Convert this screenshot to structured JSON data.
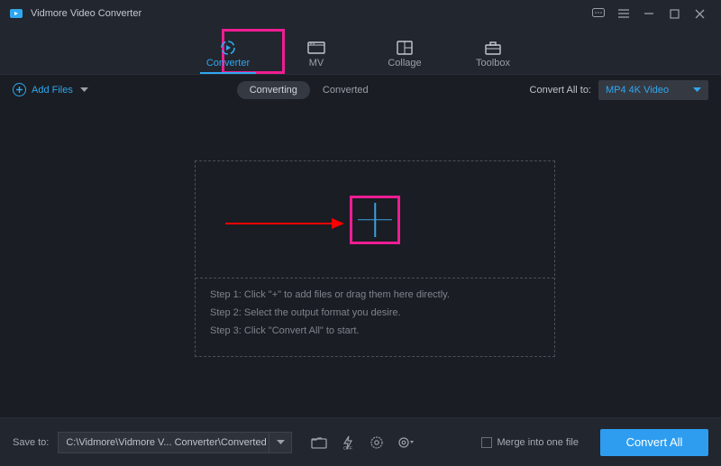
{
  "app": {
    "title": "Vidmore Video Converter"
  },
  "main_tabs": [
    {
      "label": "Converter",
      "active": true
    },
    {
      "label": "MV",
      "active": false
    },
    {
      "label": "Collage",
      "active": false
    },
    {
      "label": "Toolbox",
      "active": false
    }
  ],
  "toolbar": {
    "add_files_label": "Add Files",
    "sub_tabs": {
      "converting": "Converting",
      "converted": "Converted"
    },
    "convert_all_to_label": "Convert All to:",
    "selected_format": "MP4 4K Video"
  },
  "drop_panel": {
    "step1": "Step 1: Click \"+\" to add files or drag them here directly.",
    "step2": "Step 2: Select the output format you desire.",
    "step3": "Step 3: Click \"Convert All\" to start."
  },
  "footer": {
    "save_to_label": "Save to:",
    "save_path": "C:\\Vidmore\\Vidmore V... Converter\\Converted",
    "merge_label": "Merge into one file",
    "convert_all_label": "Convert All"
  }
}
